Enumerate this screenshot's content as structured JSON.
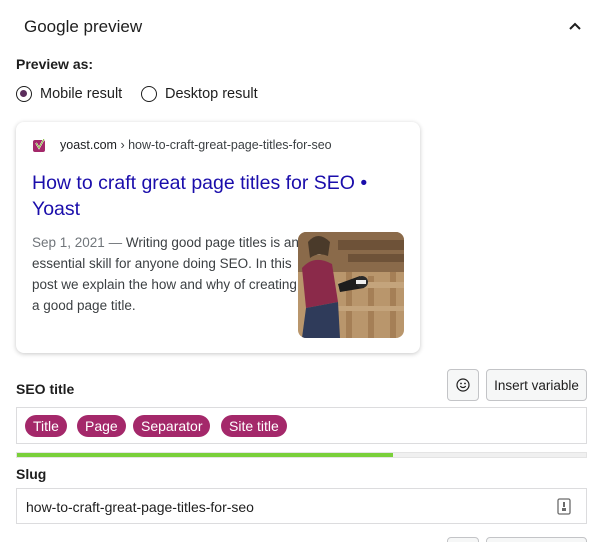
{
  "panel": {
    "title": "Google preview",
    "collapse_icon": "chevron-up-icon"
  },
  "preview_mode": {
    "label": "Preview as:",
    "options": [
      {
        "label": "Mobile result",
        "selected": true
      },
      {
        "label": "Desktop result",
        "selected": false
      }
    ]
  },
  "search_result": {
    "favicon": "yoast-logo-icon",
    "site": "yoast.com",
    "path": " › how-to-craft-great-page-titles-for-seo",
    "title": "How to craft great page titles for SEO • Yoast",
    "date": "Sep 1, 2021",
    "dash": " — ",
    "description": "Writing good page titles is an essential skill for anyone doing SEO. In this post we explain the how and why of creating a good page title.",
    "thumbnail": "woman-with-megaphone-on-fence-image"
  },
  "seo_title": {
    "label": "SEO title",
    "emoji_button_icon": "smiley-icon",
    "insert_variable_label": "Insert variable",
    "variables": [
      "Title",
      "Page",
      "Separator",
      "Site title"
    ],
    "progress": 0.66,
    "progress_color": "#7ad03a"
  },
  "slug": {
    "label": "Slug",
    "value": "how-to-craft-great-page-titles-for-seo",
    "field_icon": "document-key-icon"
  },
  "colors": {
    "variable_pill": "#a4286a",
    "link_title": "#1a0dab",
    "radio_selected": "#5b2d5c"
  }
}
